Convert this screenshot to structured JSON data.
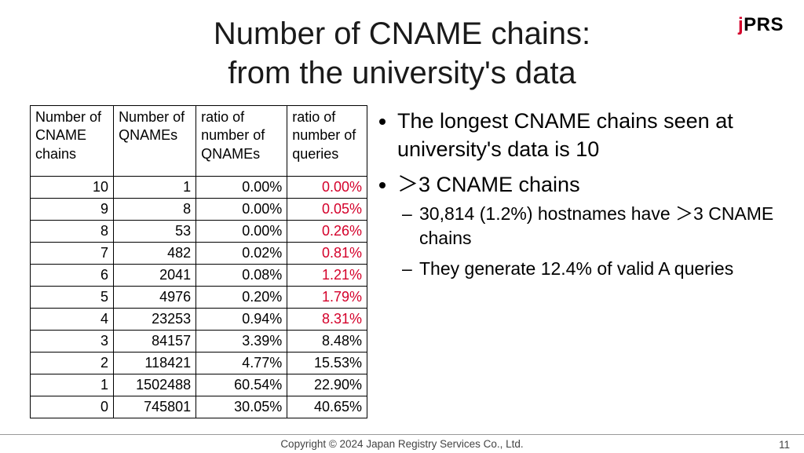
{
  "logo_text": "jPRS",
  "title_line1": "Number of CNAME chains:",
  "title_line2": "from the university's data",
  "chart_data": {
    "type": "table",
    "headers": [
      "Number of CNAME chains",
      "Number of QNAMEs",
      "ratio of number of QNAMEs",
      "ratio of number of queries"
    ],
    "rows": [
      {
        "chains": 10,
        "qnames": 1,
        "ratio_qnames": "0.00%",
        "ratio_queries": "0.00%",
        "hl": true
      },
      {
        "chains": 9,
        "qnames": 8,
        "ratio_qnames": "0.00%",
        "ratio_queries": "0.05%",
        "hl": true
      },
      {
        "chains": 8,
        "qnames": 53,
        "ratio_qnames": "0.00%",
        "ratio_queries": "0.26%",
        "hl": true
      },
      {
        "chains": 7,
        "qnames": 482,
        "ratio_qnames": "0.02%",
        "ratio_queries": "0.81%",
        "hl": true
      },
      {
        "chains": 6,
        "qnames": 2041,
        "ratio_qnames": "0.08%",
        "ratio_queries": "1.21%",
        "hl": true
      },
      {
        "chains": 5,
        "qnames": 4976,
        "ratio_qnames": "0.20%",
        "ratio_queries": "1.79%",
        "hl": true
      },
      {
        "chains": 4,
        "qnames": 23253,
        "ratio_qnames": "0.94%",
        "ratio_queries": "8.31%",
        "hl": true
      },
      {
        "chains": 3,
        "qnames": 84157,
        "ratio_qnames": "3.39%",
        "ratio_queries": "8.48%",
        "hl": false
      },
      {
        "chains": 2,
        "qnames": 118421,
        "ratio_qnames": "4.77%",
        "ratio_queries": "15.53%",
        "hl": false
      },
      {
        "chains": 1,
        "qnames": 1502488,
        "ratio_qnames": "60.54%",
        "ratio_queries": "22.90%",
        "hl": false
      },
      {
        "chains": 0,
        "qnames": 745801,
        "ratio_qnames": "30.05%",
        "ratio_queries": "40.65%",
        "hl": false
      }
    ]
  },
  "bullets": {
    "b1": "The longest CNAME chains seen at university's data is 10",
    "b2": "＞3 CNAME chains",
    "b2a": "30,814 (1.2%) hostnames have ＞3 CNAME chains",
    "b2b": "They generate 12.4% of valid A queries"
  },
  "footer": "Copyright © 2024 Japan Registry Services Co., Ltd.",
  "page": "11"
}
